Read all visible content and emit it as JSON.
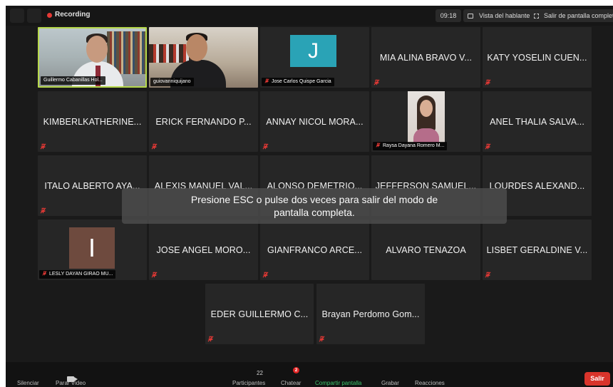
{
  "topbar": {
    "recording_label": "Recording",
    "time": "09:18",
    "speaker_view_label": "Vista del hablante",
    "exit_fullscreen_label": "Salir de pantalla completa"
  },
  "tiles": {
    "r1": [
      {
        "type": "video",
        "name": "Guillermo Cabanillas Hol..."
      },
      {
        "type": "video",
        "name": "guiovanniquijano"
      },
      {
        "type": "avatar",
        "initial": "J",
        "avatar_color": "#2aa3b6",
        "name": "Jose Carlos Quispe Garcia"
      },
      {
        "type": "text",
        "name": "MIA ALINA BRAVO V..."
      },
      {
        "type": "text",
        "name": "KATY YOSELIN CUEN..."
      }
    ],
    "r2": [
      {
        "type": "text",
        "name": "KIMBERLKATHERINE..."
      },
      {
        "type": "text",
        "name": "ERICK FERNANDO P..."
      },
      {
        "type": "text",
        "name": "ANNAY NICOL MORA..."
      },
      {
        "type": "photo",
        "name": "Raysa Dayana Romero M..."
      },
      {
        "type": "text",
        "name": "ANEL THALIA SALVA..."
      }
    ],
    "r3": [
      {
        "type": "text",
        "name": "ITALO ALBERTO AYA..."
      },
      {
        "type": "text",
        "name": "ALEXIS MANUEL VAL..."
      },
      {
        "type": "text",
        "name": "ALONSO DEMETRIO..."
      },
      {
        "type": "text",
        "name": "JEFFERSON SAMUEL..."
      },
      {
        "type": "text",
        "name": "LOURDES ALEXAND..."
      }
    ],
    "r4": [
      {
        "type": "avatar",
        "initial": "I",
        "avatar_color": "#6e4a3e",
        "name": "LESLY DAYAN GIRAO MU..."
      },
      {
        "type": "text",
        "name": "JOSE ANGEL MORO..."
      },
      {
        "type": "text",
        "name": "GIANFRANCO ARCE..."
      },
      {
        "type": "text",
        "name": "ALVARO TENAZOA"
      },
      {
        "type": "text",
        "name": "LISBET GERALDINE V..."
      }
    ],
    "r5": [
      {
        "type": "text",
        "name": "EDER GUILLERMO C..."
      },
      {
        "type": "text",
        "name": "Brayan Perdomo Gom..."
      }
    ]
  },
  "overlay": {
    "line1": "Presione ESC o pulse dos veces para salir del modo de",
    "line2": "pantalla completa."
  },
  "toolbar": {
    "mute_label": "Silenciar",
    "stop_video_label": "Parar Video",
    "participants_count": "22",
    "participants_label": "Participantes",
    "chat_badge": "2",
    "chat_label": "Chatear",
    "share_label": "Compartir pantalla",
    "record_label": "Grabar",
    "reactions_label": "Reacciones",
    "leave_label": "Salir"
  },
  "colors": {
    "active_speaker_border": "#b6d84b",
    "share_label": "#3cc46c",
    "leave_button": "#d9342b",
    "muted_icon": "#e53935"
  }
}
